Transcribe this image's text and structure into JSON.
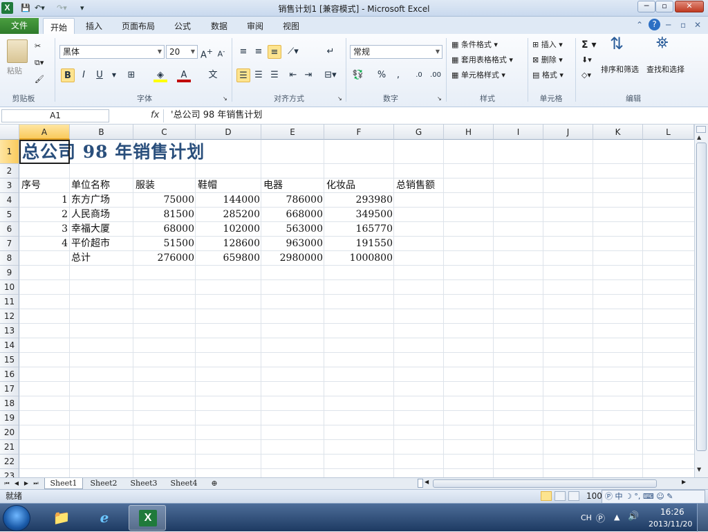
{
  "window": {
    "title": "销售计划1  [兼容模式] - Microsoft Excel",
    "app_icon": "X"
  },
  "tabs": [
    "开始",
    "插入",
    "页面布局",
    "公式",
    "数据",
    "审阅",
    "视图"
  ],
  "file_tab": "文件",
  "ribbon": {
    "clipboard": {
      "label": "剪贴板",
      "paste": "粘贴"
    },
    "font": {
      "label": "字体",
      "name": "黑体",
      "size": "20"
    },
    "alignment": {
      "label": "对齐方式"
    },
    "number": {
      "label": "数字",
      "format": "常规"
    },
    "styles": {
      "label": "样式",
      "conditional": "条件格式",
      "table": "套用表格格式",
      "cell": "单元格样式"
    },
    "cells": {
      "label": "单元格",
      "insert": "插入",
      "delete": "删除",
      "format": "格式"
    },
    "editing": {
      "label": "编辑",
      "sort": "排序和筛选",
      "find": "查找和选择",
      "sigma": "Σ"
    }
  },
  "formula_bar": {
    "name_box": "A1",
    "fx": "fx",
    "content": "'总公司 98 年销售计划"
  },
  "columns": [
    "A",
    "B",
    "C",
    "D",
    "E",
    "F",
    "G",
    "H",
    "I",
    "J",
    "K",
    "L"
  ],
  "rows": [
    "1",
    "2",
    "3",
    "4",
    "5",
    "6",
    "7",
    "8",
    "9",
    "10",
    "11",
    "12",
    "13",
    "14",
    "15",
    "16",
    "17",
    "18",
    "19",
    "20",
    "21",
    "22",
    "23"
  ],
  "sheet": {
    "title": "总公司 98 年销售计划",
    "headers": [
      "序号",
      "单位名称",
      "服装",
      "鞋帽",
      "电器",
      "化妆品",
      "总销售额"
    ],
    "data": [
      [
        "1",
        "东方广场",
        "75000",
        "144000",
        "786000",
        "293980"
      ],
      [
        "2",
        "人民商场",
        "81500",
        "285200",
        "668000",
        "349500"
      ],
      [
        "3",
        "幸福大厦",
        "68000",
        "102000",
        "563000",
        "165770"
      ],
      [
        "4",
        "平价超市",
        "51500",
        "128600",
        "963000",
        "191550"
      ]
    ],
    "total": [
      "总计",
      "276000",
      "659800",
      "2980000",
      "1000800"
    ]
  },
  "sheet_tabs": [
    "Sheet1",
    "Sheet2",
    "Sheet3",
    "Sheet4"
  ],
  "status": {
    "ready": "就绪",
    "zoom": "100"
  },
  "taskbar": {
    "ime": "CH",
    "time": "16:26",
    "date": "2013/11/20"
  },
  "colors": {
    "title_text": "#2a4f7c",
    "file_tab": "#2e7b2b",
    "selection": "#f9ca5c"
  }
}
